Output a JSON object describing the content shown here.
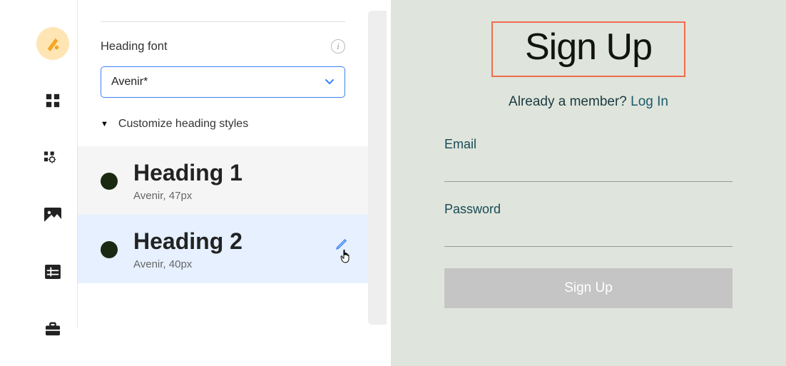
{
  "icon_rail": {
    "theme": "theme",
    "items": [
      "apps",
      "settings",
      "image",
      "table",
      "briefcase"
    ]
  },
  "panel": {
    "heading_font_label": "Heading font",
    "font_value": "Avenir*",
    "customize_label": "Customize heading styles",
    "headings": [
      {
        "name": "Heading 1",
        "sub": "Avenir, 47px"
      },
      {
        "name": "Heading 2",
        "sub": "Avenir, 40px"
      }
    ]
  },
  "preview": {
    "title": "Sign Up",
    "member_text": "Already a member? ",
    "login_text": "Log In",
    "email_label": "Email",
    "password_label": "Password",
    "button_label": "Sign Up"
  }
}
